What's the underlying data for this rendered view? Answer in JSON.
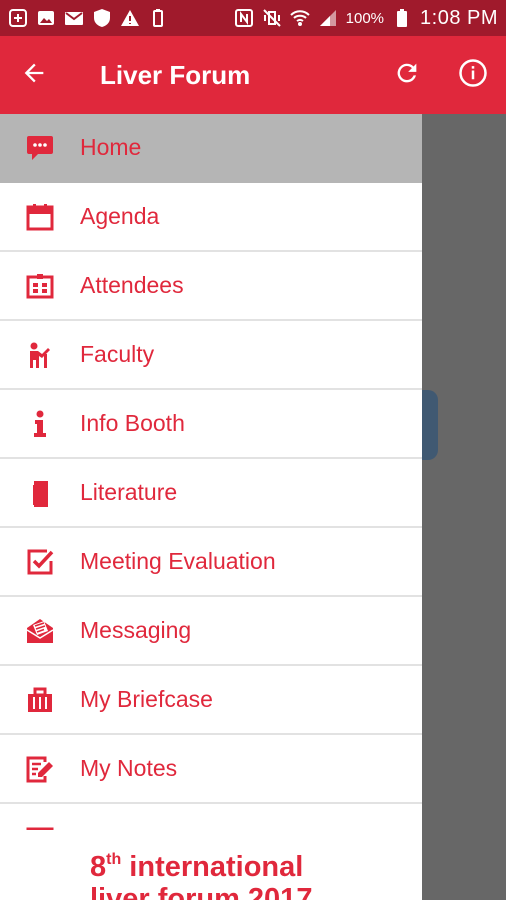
{
  "status_bar": {
    "battery": "100%",
    "time": "1:08 PM"
  },
  "app_bar": {
    "title": "Liver Forum"
  },
  "menu": [
    {
      "label": "Home",
      "icon": "chat-bubble-icon",
      "active": true
    },
    {
      "label": "Agenda",
      "icon": "calendar-icon",
      "active": false
    },
    {
      "label": "Attendees",
      "icon": "id-card-icon",
      "active": false
    },
    {
      "label": "Faculty",
      "icon": "presenter-icon",
      "active": false
    },
    {
      "label": "Info Booth",
      "icon": "info-icon",
      "active": false
    },
    {
      "label": "Literature",
      "icon": "document-icon",
      "active": false
    },
    {
      "label": "Meeting Evaluation",
      "icon": "checkbox-icon",
      "active": false
    },
    {
      "label": "Messaging",
      "icon": "envelope-icon",
      "active": false
    },
    {
      "label": "My Briefcase",
      "icon": "briefcase-icon",
      "active": false
    },
    {
      "label": "My Notes",
      "icon": "notes-icon",
      "active": false
    }
  ],
  "banner": {
    "number": "8",
    "suffix": "th",
    "line1_rest": " international",
    "line2": "liver forum 2017"
  },
  "colors": {
    "accent": "#e0283c",
    "status_bar": "#a01a2c",
    "active_item_bg": "#b5b5b5",
    "scrim": "#676767"
  }
}
